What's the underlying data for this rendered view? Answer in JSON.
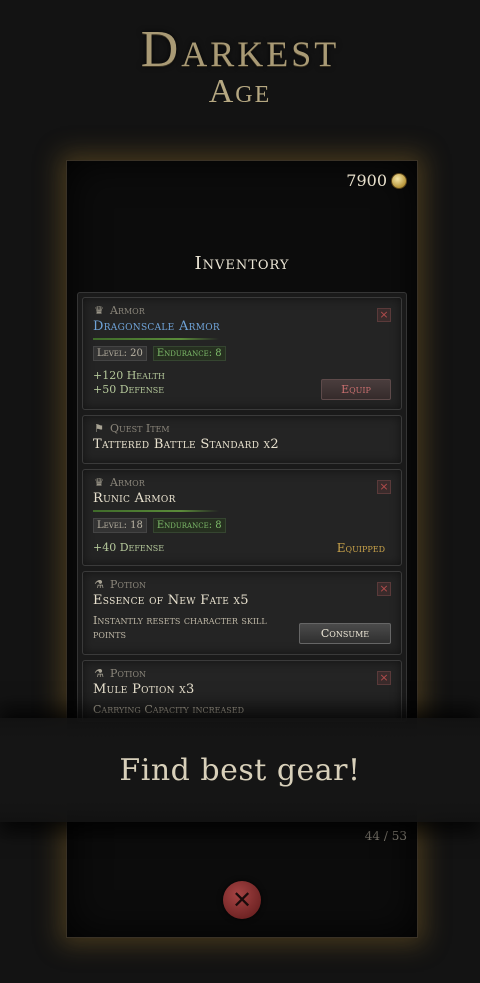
{
  "logo": {
    "line1": "Darkest",
    "line2": "Age"
  },
  "gold": {
    "amount": "7900",
    "icon": "coin-icon"
  },
  "inventory_title": "Inventory",
  "items": [
    {
      "category": "Armor",
      "category_icon": "armor-icon",
      "name": "Dragonscale Armor",
      "stats": [
        "Level: 20",
        "Endurance: 8"
      ],
      "bonuses": [
        "+120 Health",
        "+50 Defense"
      ],
      "action": "Equip"
    },
    {
      "category": "Quest Item",
      "category_icon": "quest-item-icon",
      "name": "Tattered Battle Standard x2"
    },
    {
      "category": "Armor",
      "category_icon": "armor-icon",
      "name": "Runic Armor",
      "stats": [
        "Level: 18",
        "Endurance: 8"
      ],
      "bonuses": [
        "+40 Defense"
      ],
      "status": "Equipped"
    },
    {
      "category": "Potion",
      "category_icon": "potion-icon",
      "name": "Essence of New Fate x5",
      "description": "Instantly resets character skill points",
      "action": "Consume"
    },
    {
      "category": "Potion",
      "category_icon": "potion-icon",
      "name": "Mule Potion x3",
      "description": "Carrying Capacity increased"
    }
  ],
  "banner": "Find best gear!",
  "pager": "44 / 53"
}
